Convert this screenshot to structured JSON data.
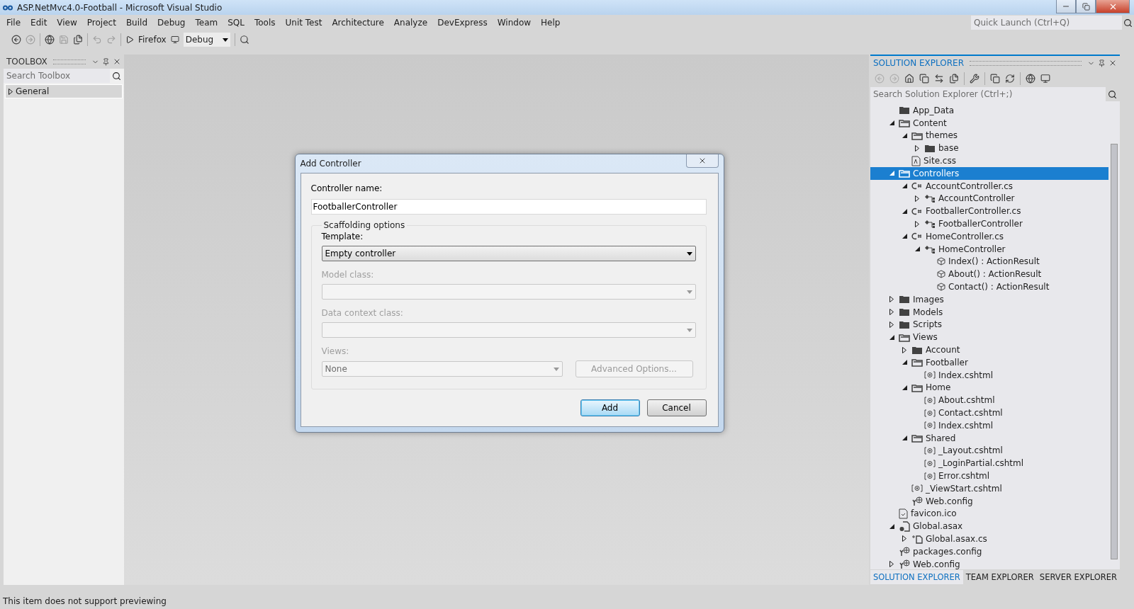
{
  "window": {
    "title": "ASP.NetMvc4.0-Football - Microsoft Visual Studio"
  },
  "quick_launch": {
    "placeholder": "Quick Launch (Ctrl+Q)"
  },
  "menu": [
    "File",
    "Edit",
    "View",
    "Project",
    "Build",
    "Debug",
    "Team",
    "SQL",
    "Tools",
    "Unit Test",
    "Architecture",
    "Analyze",
    "DevExpress",
    "Window",
    "Help"
  ],
  "toolbar": {
    "run_target": "Firefox",
    "configuration": "Debug"
  },
  "toolbox": {
    "title": "TOOLBOX",
    "search": {
      "placeholder": "Search Toolbox"
    },
    "items": [
      {
        "label": "General",
        "expanded": false
      }
    ]
  },
  "dialog": {
    "title": "Add Controller",
    "name_label": "Controller name:",
    "name_value": "FootballerController",
    "group_title": "Scaffolding options",
    "fields": [
      {
        "label": "Template:",
        "value": "Empty controller",
        "disabled": false
      },
      {
        "label": "Model class:",
        "disabled": true
      },
      {
        "label": "Data context class:",
        "disabled": true
      }
    ],
    "views_label": "Views:",
    "views_value": "None",
    "advanced_button": "Advanced Options...",
    "buttons": [
      {
        "label": "Add",
        "default": true
      },
      {
        "label": "Cancel",
        "default": false
      }
    ]
  },
  "solution_explorer": {
    "title": "SOLUTION EXPLORER",
    "search": {
      "placeholder": "Search Solution Explorer (Ctrl+;)"
    },
    "tree": [
      {
        "label": "App_Data",
        "kind": "folder",
        "selected": false
      },
      {
        "label": "Content",
        "kind": "folder-open",
        "expanded": true,
        "selected": false,
        "children": [
          {
            "label": "themes",
            "kind": "folder-open",
            "expanded": true,
            "selected": false,
            "children": [
              {
                "label": "base",
                "kind": "folder",
                "expanded": false,
                "selected": false
              }
            ]
          },
          {
            "label": "Site.css",
            "kind": "css",
            "selected": false
          }
        ]
      },
      {
        "label": "Controllers",
        "kind": "folder-open",
        "expanded": true,
        "selected": true,
        "children": [
          {
            "label": "AccountController.cs",
            "kind": "cs",
            "expanded": true,
            "selected": false,
            "children": [
              {
                "label": "AccountController",
                "kind": "class",
                "expanded": false,
                "selected": false
              }
            ]
          },
          {
            "label": "FootballerController.cs",
            "kind": "cs",
            "expanded": true,
            "selected": false,
            "children": [
              {
                "label": "FootballerController",
                "kind": "class",
                "expanded": false,
                "selected": false
              }
            ]
          },
          {
            "label": "HomeController.cs",
            "kind": "cs",
            "expanded": true,
            "selected": false,
            "children": [
              {
                "label": "HomeController",
                "kind": "class",
                "expanded": true,
                "selected": false,
                "children": [
                  {
                    "label": "Index() : ActionResult",
                    "kind": "method",
                    "selected": false
                  },
                  {
                    "label": "About() : ActionResult",
                    "kind": "method",
                    "selected": false
                  },
                  {
                    "label": "Contact() : ActionResult",
                    "kind": "method",
                    "selected": false
                  }
                ]
              }
            ]
          }
        ]
      },
      {
        "label": "Images",
        "kind": "folder",
        "expanded": false,
        "selected": false
      },
      {
        "label": "Models",
        "kind": "folder",
        "expanded": false,
        "selected": false
      },
      {
        "label": "Scripts",
        "kind": "folder",
        "expanded": false,
        "selected": false
      },
      {
        "label": "Views",
        "kind": "folder-open",
        "expanded": true,
        "selected": false,
        "children": [
          {
            "label": "Account",
            "kind": "folder",
            "expanded": false,
            "selected": false
          },
          {
            "label": "Footballer",
            "kind": "folder-open",
            "expanded": true,
            "selected": false,
            "children": [
              {
                "label": "Index.cshtml",
                "kind": "cshtml",
                "selected": false
              }
            ]
          },
          {
            "label": "Home",
            "kind": "folder-open",
            "expanded": true,
            "selected": false,
            "children": [
              {
                "label": "About.cshtml",
                "kind": "cshtml",
                "selected": false
              },
              {
                "label": "Contact.cshtml",
                "kind": "cshtml",
                "selected": false
              },
              {
                "label": "Index.cshtml",
                "kind": "cshtml",
                "selected": false
              }
            ]
          },
          {
            "label": "Shared",
            "kind": "folder-open",
            "expanded": true,
            "selected": false,
            "children": [
              {
                "label": "_Layout.cshtml",
                "kind": "cshtml",
                "selected": false
              },
              {
                "label": "_LoginPartial.cshtml",
                "kind": "cshtml",
                "selected": false
              },
              {
                "label": "Error.cshtml",
                "kind": "cshtml",
                "selected": false
              }
            ]
          },
          {
            "label": "_ViewStart.cshtml",
            "kind": "cshtml",
            "selected": false
          },
          {
            "label": "Web.config",
            "kind": "config",
            "selected": false
          }
        ]
      },
      {
        "label": "favicon.ico",
        "kind": "ico",
        "selected": false
      },
      {
        "label": "Global.asax",
        "kind": "asax",
        "expanded": true,
        "selected": false,
        "children": [
          {
            "label": "Global.asax.cs",
            "kind": "codebehind",
            "expanded": false,
            "selected": false
          }
        ]
      },
      {
        "label": "packages.config",
        "kind": "config",
        "selected": false
      },
      {
        "label": "Web.config",
        "kind": "config",
        "expanded": false,
        "selected": false
      }
    ],
    "tabs": [
      {
        "label": "SOLUTION EXPLORER",
        "selected": true
      },
      {
        "label": "TEAM EXPLORER",
        "selected": false
      },
      {
        "label": "SERVER EXPLORER",
        "selected": false
      }
    ]
  },
  "status_bar": {
    "text": "This item does not support previewing"
  }
}
